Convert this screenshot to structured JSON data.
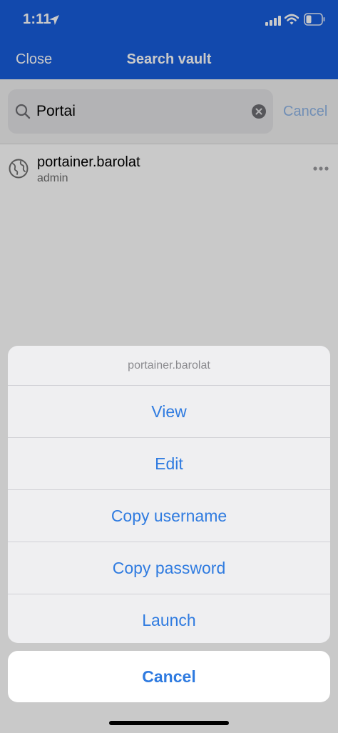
{
  "status_bar": {
    "time": "1:11",
    "icons": [
      "location-arrow-icon",
      "cellular-signal-icon",
      "wifi-icon",
      "battery-icon"
    ]
  },
  "nav": {
    "close_label": "Close",
    "title": "Search vault"
  },
  "search": {
    "value": "Portai",
    "cancel_label": "Cancel",
    "icons": [
      "search-icon",
      "clear-icon"
    ]
  },
  "results": [
    {
      "title": "portainer.barolat",
      "subtitle": "admin",
      "icon": "globe-icon"
    }
  ],
  "action_sheet": {
    "title": "portainer.barolat",
    "actions": [
      {
        "label": "View"
      },
      {
        "label": "Edit"
      },
      {
        "label": "Copy username"
      },
      {
        "label": "Copy password"
      },
      {
        "label": "Launch"
      }
    ],
    "cancel_label": "Cancel"
  },
  "colors": {
    "brand_blue": "#175ddc",
    "action_blue": "#2f7be0",
    "sheet_background": "#efeff1",
    "dim_overlay": "rgba(0,0,0,0.21)"
  }
}
